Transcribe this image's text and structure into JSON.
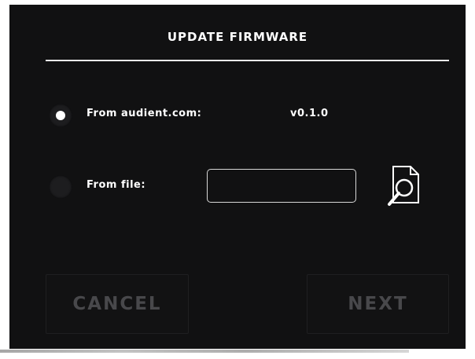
{
  "dialog": {
    "title": "UPDATE FIRMWARE"
  },
  "options": {
    "online": {
      "label": "From audient.com:",
      "version": "v0.1.0",
      "selected": true
    },
    "file": {
      "label": "From file:",
      "value": "",
      "selected": false,
      "browse_icon": "file-search-icon"
    }
  },
  "buttons": {
    "cancel": "CANCEL",
    "next": "NEXT"
  },
  "colors": {
    "background": "#111112",
    "text": "#ffffff",
    "disabled_text": "#48484b"
  }
}
